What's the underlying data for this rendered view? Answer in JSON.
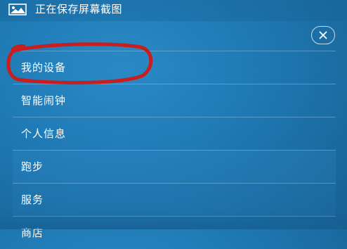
{
  "notification": {
    "icon": "image-icon",
    "text": "正在保存屏幕截图"
  },
  "close_button": {
    "icon": "close-icon"
  },
  "menu": {
    "items": [
      {
        "label": "我的设备",
        "highlighted": true
      },
      {
        "label": "智能闹钟"
      },
      {
        "label": "个人信息"
      },
      {
        "label": "跑步"
      },
      {
        "label": "服务"
      },
      {
        "label": "商店"
      }
    ]
  },
  "colors": {
    "background": "#1f78b2",
    "annotation": "#c81e1e",
    "text": "#ffffff"
  }
}
